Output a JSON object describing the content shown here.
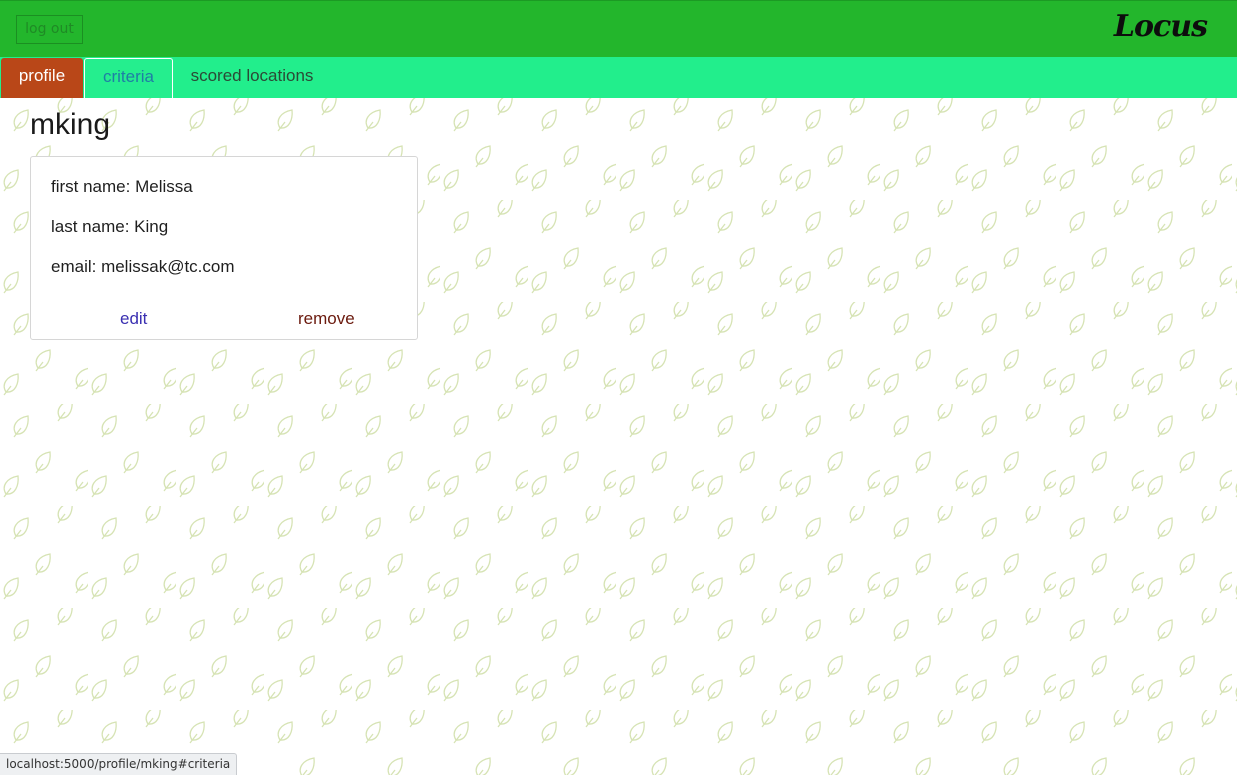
{
  "header": {
    "logout_label": "log out",
    "logo_text": "Locus",
    "background_color": "#23b62c"
  },
  "tabs": [
    {
      "label": "profile",
      "active": true,
      "color": "#b94718"
    },
    {
      "label": "criteria",
      "active": false
    },
    {
      "label": "scored locations",
      "active": false
    }
  ],
  "profile": {
    "username": "mking",
    "first_name_line": "first name: Melissa",
    "last_name_line": "last name: King",
    "email_line": "email: melissak@tc.com",
    "edit_label": "edit",
    "remove_label": "remove"
  },
  "background": {
    "pattern_icon": "leaf-icon",
    "pattern_color": "#d6e3b4"
  },
  "status_bar": {
    "url": "localhost:5000/profile/mking#criteria"
  }
}
